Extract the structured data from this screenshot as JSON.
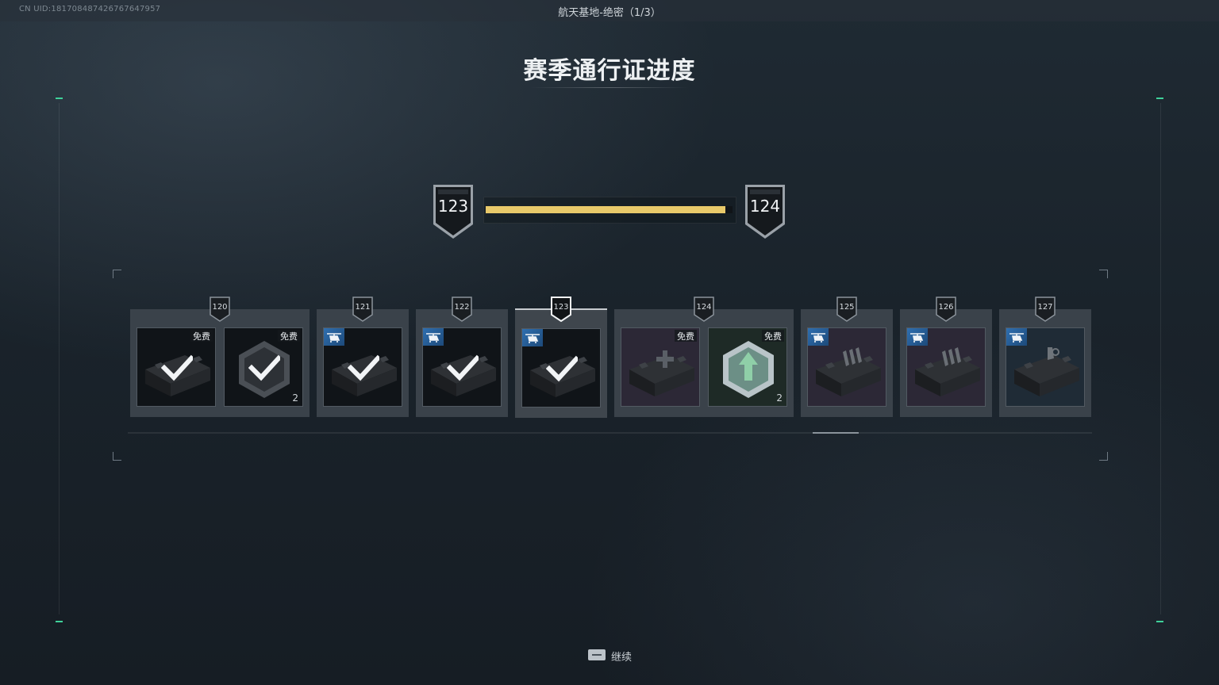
{
  "header": {
    "uid": "CN UID:1817084874267676​47957",
    "map_name": "航天基地-绝密（1/3）"
  },
  "title": "赛季通行证进度",
  "progress": {
    "current_level": "123",
    "next_level": "124",
    "fill_fraction": 0.97,
    "fill_color": "#e8c96a"
  },
  "tiers": [
    {
      "level": "120",
      "items": [
        {
          "type": "crate",
          "claimed": true,
          "tag": "免费",
          "count": "",
          "bg": "dark"
        },
        {
          "type": "hex",
          "claimed": true,
          "tag": "免费",
          "count": "2",
          "bg": "dark"
        }
      ]
    },
    {
      "level": "121",
      "items": [
        {
          "type": "crate",
          "claimed": true,
          "tag": "",
          "count": "",
          "bg": "dark",
          "premium": true
        }
      ]
    },
    {
      "level": "122",
      "items": [
        {
          "type": "crate",
          "claimed": true,
          "tag": "",
          "count": "",
          "bg": "dark",
          "premium": true
        }
      ]
    },
    {
      "level": "123",
      "current": true,
      "items": [
        {
          "type": "crate",
          "claimed": true,
          "tag": "",
          "count": "",
          "bg": "dark",
          "premium": true
        }
      ]
    },
    {
      "level": "124",
      "items": [
        {
          "type": "medkit",
          "claimed": false,
          "tag": "免费",
          "count": "",
          "bg": "purple"
        },
        {
          "type": "hex-arrow",
          "claimed": false,
          "tag": "免费",
          "count": "2",
          "bg": "green"
        }
      ]
    },
    {
      "level": "125",
      "items": [
        {
          "type": "ammo-crate",
          "claimed": false,
          "tag": "",
          "count": "",
          "bg": "purple",
          "premium": true
        }
      ]
    },
    {
      "level": "126",
      "items": [
        {
          "type": "ammo-crate",
          "claimed": false,
          "tag": "",
          "count": "",
          "bg": "purple",
          "premium": true
        }
      ]
    },
    {
      "level": "127",
      "items": [
        {
          "type": "tool-crate",
          "claimed": false,
          "tag": "",
          "count": "",
          "bg": "blue",
          "premium": true
        }
      ]
    }
  ],
  "scrollbar": {
    "position_fraction": 0.71,
    "thumb_fraction": 0.048
  },
  "footer": {
    "continue_label": "继续",
    "key_icon": "keyboard-key-icon"
  },
  "colors": {
    "accent_green": "#3fd19a",
    "premium_blue": "#2f6fb0"
  }
}
